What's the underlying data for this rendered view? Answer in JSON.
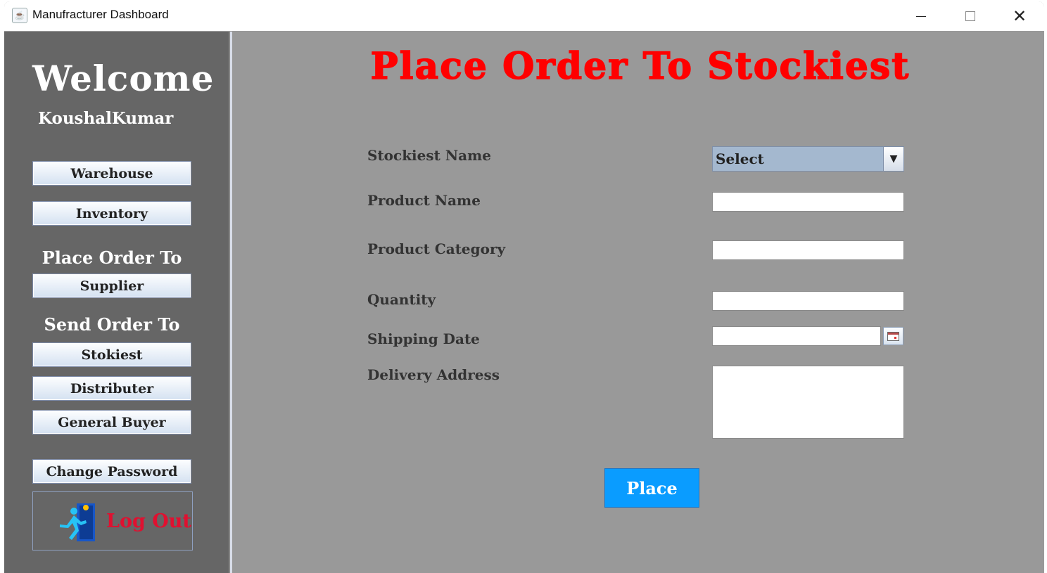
{
  "window": {
    "title": "Manufracturer Dashboard",
    "controls": {
      "minimize": "minimize-icon",
      "maximize": "maximize-icon",
      "close": "close-icon"
    }
  },
  "sidebar": {
    "welcome": "Welcome",
    "username": "KoushalKumar",
    "buttons": {
      "warehouse": "Warehouse",
      "inventory": "Inventory",
      "place_order_heading": "Place Order To",
      "supplier": "Supplier",
      "send_order_heading": "Send Order To",
      "stokiest": "Stokiest",
      "distributer": "Distributer",
      "general_buyer": "General Buyer",
      "change_password": "Change Password"
    },
    "logout": {
      "label": "Log Out",
      "icon": "logout-door-runner-icon"
    }
  },
  "main": {
    "title": "Place Order To Stockiest",
    "form": {
      "stockiest_name": {
        "label": "Stockiest Name",
        "selected": "Select"
      },
      "product_name": {
        "label": "Product Name",
        "value": ""
      },
      "product_category": {
        "label": "Product Category",
        "value": ""
      },
      "quantity": {
        "label": "Quantity",
        "value": ""
      },
      "shipping_date": {
        "label": "Shipping Date",
        "value": ""
      },
      "delivery_address": {
        "label": "Delivery Address",
        "value": ""
      }
    },
    "place_button": "Place"
  },
  "colors": {
    "title_red": "#ff0000",
    "sidebar_bg": "#666666",
    "main_bg": "#999999",
    "place_button_bg": "#0a9cff",
    "logout_red": "#e01030"
  }
}
